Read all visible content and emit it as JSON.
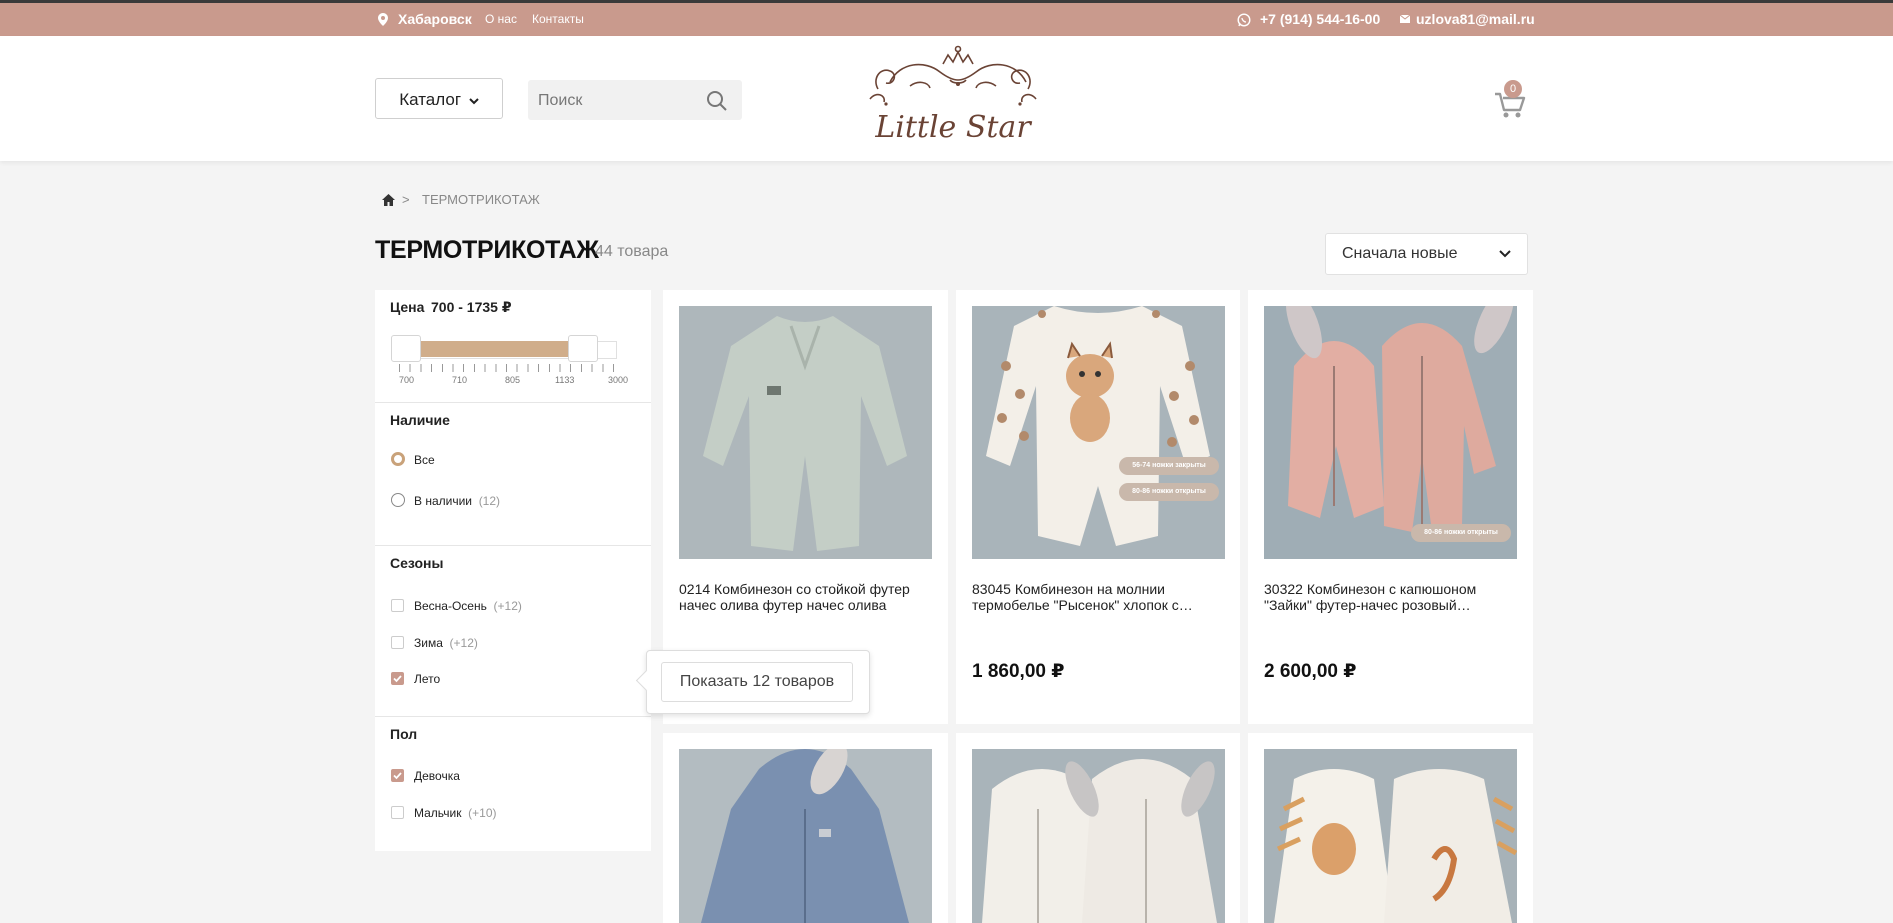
{
  "topbar": {
    "city": "Хабаровск",
    "about": "О нас",
    "contacts": "Контакты",
    "phone": "+7 (914) 544-16-00",
    "email": "uzlova81@mail.ru"
  },
  "header": {
    "catalog_label": "Каталог",
    "search_placeholder": "Поиск",
    "logo_text": "Little Star",
    "cart_count": "0"
  },
  "breadcrumb": {
    "current": "ТЕРМОТРИКОТАЖ"
  },
  "page": {
    "title": "ТЕРМОТРИКОТАЖ",
    "count": "44 товара",
    "sort_label": "Сначала новые"
  },
  "filters": {
    "price": {
      "title": "Цена",
      "range_text": "700 - 1735 ₽",
      "min": 700,
      "max": 1735,
      "ticks": [
        "700",
        "710",
        "805",
        "1133",
        "3000"
      ]
    },
    "availability": {
      "title": "Наличие",
      "options": [
        {
          "label": "Все",
          "count": "",
          "selected": true
        },
        {
          "label": "В наличии",
          "count": "(12)",
          "selected": false
        }
      ]
    },
    "seasons": {
      "title": "Сезоны",
      "options": [
        {
          "label": "Весна-Осень",
          "count": "(+12)",
          "checked": false
        },
        {
          "label": "Зима",
          "count": "(+12)",
          "checked": false
        },
        {
          "label": "Лето",
          "count": "",
          "checked": true
        }
      ]
    },
    "gender": {
      "title": "Пол",
      "options": [
        {
          "label": "Девочка",
          "count": "",
          "checked": true
        },
        {
          "label": "Мальчик",
          "count": "(+10)",
          "checked": false
        }
      ]
    }
  },
  "popup": {
    "button_label": "Показать 12 товаров"
  },
  "products": [
    {
      "name": "0214 Комбинезон со стойкой футер начес олива футер начес олива",
      "price": ""
    },
    {
      "name": "83045 Комбинезон на молнии термобелье \"Рысенок\" хлопок с…",
      "price": "1 860,00 ₽",
      "badges": [
        "56-74 ножки закрыты",
        "80-86 ножки открыты"
      ]
    },
    {
      "name": "30322 Комбинезон с капюшоном \"Зайки\" футер-начес розовый…",
      "price": "2 600,00 ₽",
      "badges": [
        "80-86 ножки открыты"
      ]
    },
    {
      "name": "",
      "price": ""
    },
    {
      "name": "",
      "price": ""
    },
    {
      "name": "",
      "price": ""
    }
  ],
  "colors": {
    "accent": "#c99a8d",
    "slider": "#d0ad8a",
    "background": "#f4f4f4"
  }
}
